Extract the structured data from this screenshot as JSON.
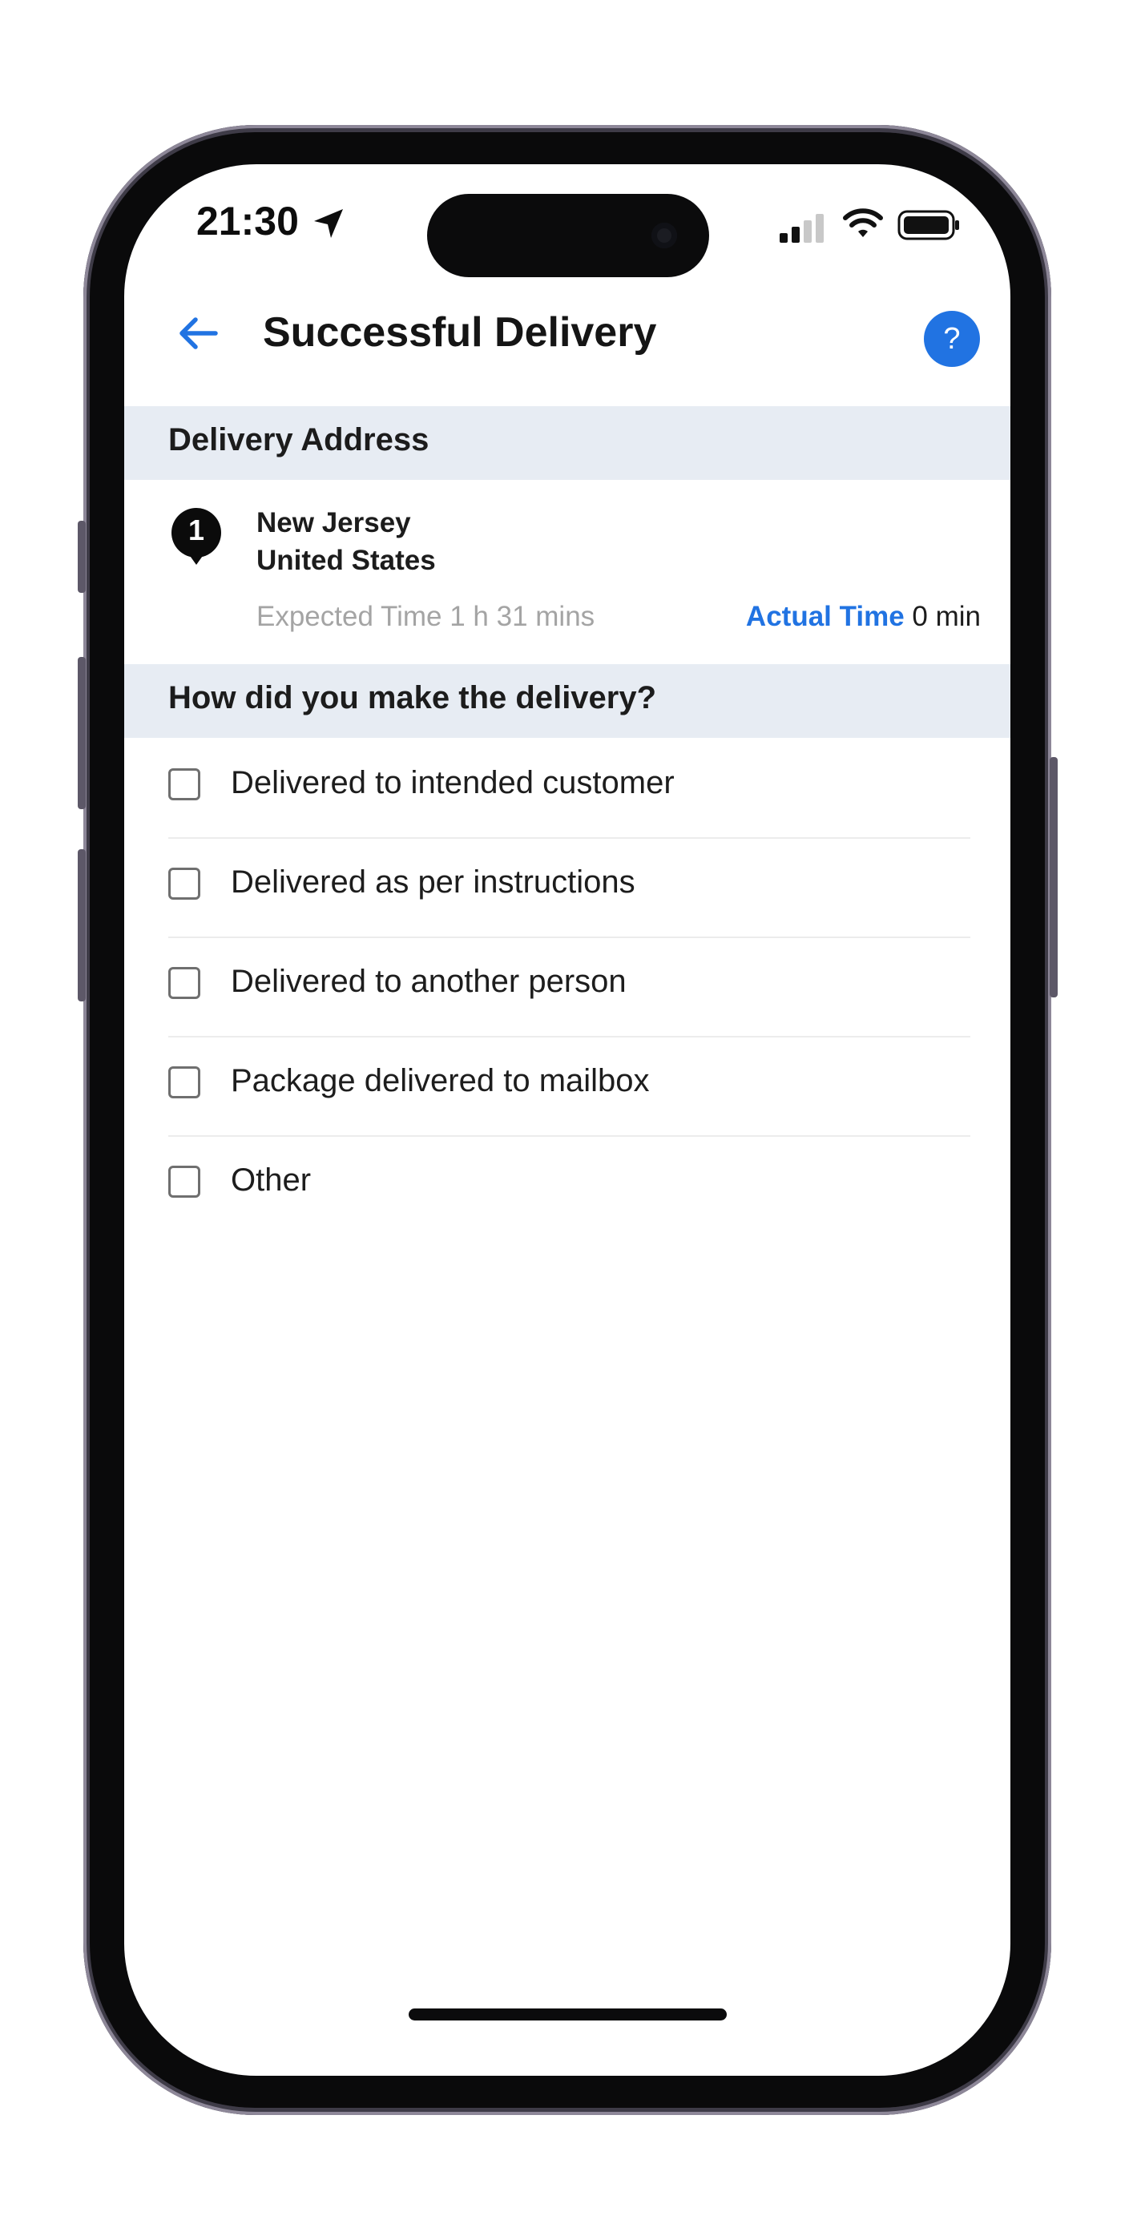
{
  "status_bar": {
    "time": "21:30",
    "location_icon": "location-arrow-icon",
    "signal_icon": "cellular-signal-icon",
    "wifi_icon": "wifi-icon",
    "battery_icon": "battery-icon"
  },
  "header": {
    "back_icon": "arrow-left-icon",
    "title": "Successful Delivery",
    "help_label": "?",
    "accent_color": "#2173e2"
  },
  "address_section": {
    "title": "Delivery Address",
    "stop_number": "1",
    "line1": "New Jersey",
    "line2": "United States",
    "expected_time": "Expected Time 1 h 31 mins",
    "actual_time_label": "Actual Time",
    "actual_time_value": "0 min"
  },
  "delivery_method_section": {
    "title": "How did you make the delivery?",
    "options": [
      {
        "label": "Delivered to intended customer",
        "checked": false
      },
      {
        "label": "Delivered as per instructions",
        "checked": false
      },
      {
        "label": "Delivered to another person",
        "checked": false
      },
      {
        "label": "Package delivered to mailbox",
        "checked": false
      },
      {
        "label": "Other",
        "checked": false
      }
    ]
  },
  "colors": {
    "section_background": "#e7ecf3",
    "accent": "#2173e2",
    "muted_text": "#a4a4a4"
  }
}
